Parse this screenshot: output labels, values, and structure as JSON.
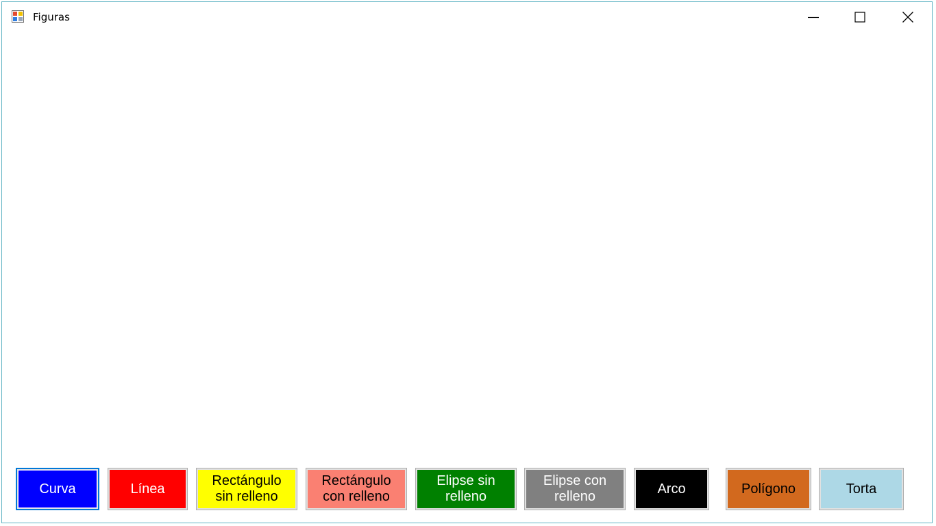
{
  "window": {
    "title": "Figuras",
    "icon": "form-app-icon",
    "controls": {
      "minimize": "minimize-icon",
      "maximize": "maximize-icon",
      "close": "close-icon"
    }
  },
  "buttons": [
    {
      "label": "Curva",
      "bg": "#0000ff",
      "fg": "#ffffff",
      "focused": true
    },
    {
      "label": "Línea",
      "bg": "#ff0000",
      "fg": "#ffffff",
      "focused": false
    },
    {
      "label": "Rectángulo\nsin relleno",
      "bg": "#ffff00",
      "fg": "#000000",
      "focused": false
    },
    {
      "label": "Rectángulo\ncon relleno",
      "bg": "#fa8072",
      "fg": "#000000",
      "focused": false
    },
    {
      "label": "Elipse sin\nrelleno",
      "bg": "#008000",
      "fg": "#ffffff",
      "focused": false
    },
    {
      "label": "Elipse con\nrelleno",
      "bg": "#808080",
      "fg": "#ffffff",
      "focused": false
    },
    {
      "label": "Arco",
      "bg": "#000000",
      "fg": "#ffffff",
      "focused": false
    },
    {
      "label": "Polígono",
      "bg": "#d2691e",
      "fg": "#000000",
      "focused": false
    },
    {
      "label": "Torta",
      "bg": "#add8e6",
      "fg": "#000000",
      "focused": false
    }
  ]
}
